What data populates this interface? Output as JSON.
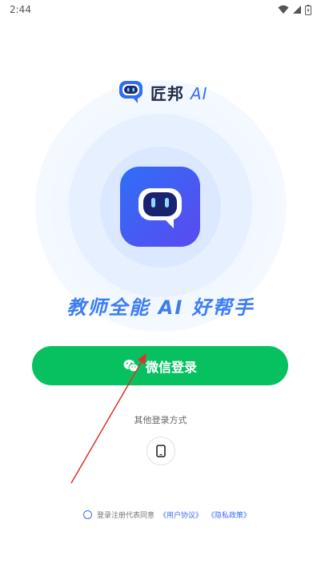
{
  "status_bar": {
    "time": "2:44"
  },
  "brand": {
    "name": "匠邦",
    "suffix": "AI"
  },
  "slogan": "教师全能 AI 好帮手",
  "login": {
    "wechat_label": "微信登录",
    "other_methods_label": "其他登录方式"
  },
  "agreement": {
    "prefix": "登录注册代表同意",
    "user_agreement": "《用户协议》",
    "privacy_policy": "《隐私政策》"
  },
  "colors": {
    "accent": "#3b6cf6",
    "wechat_green": "#07c160",
    "annotation_arrow": "#e0302a"
  }
}
